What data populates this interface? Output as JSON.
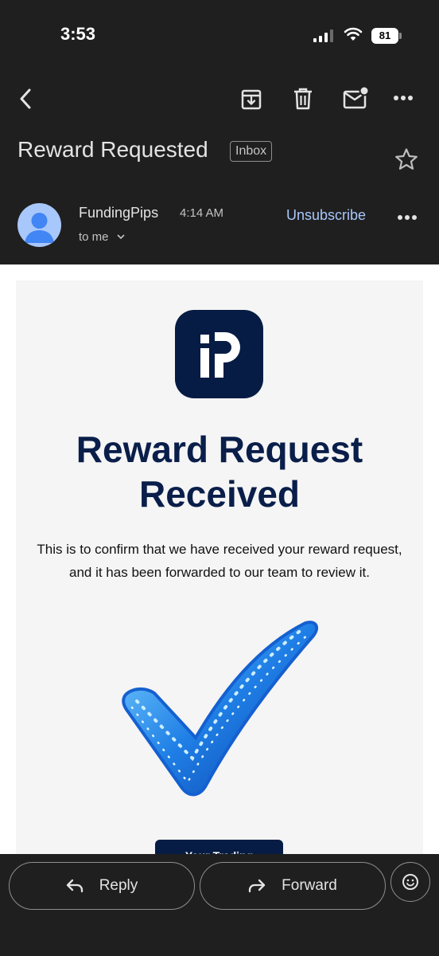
{
  "status_bar": {
    "time": "3:53",
    "battery": "81"
  },
  "header": {
    "icons": [
      "back-arrow-icon",
      "archive-icon",
      "trash-icon",
      "mark-unread-icon",
      "more-vert-icon"
    ],
    "subject": "Reward Requested",
    "label_chip": "Inbox"
  },
  "message": {
    "sender": "FundingPips",
    "time": "4:14 AM",
    "recipient": "to me",
    "unsubscribe": "Unsubscribe"
  },
  "email": {
    "headline_line1": "Reward Request",
    "headline_line2": "Received",
    "body_line1": "This is to confirm that we have received your reward request,",
    "body_line2": "and it has been forwarded to our team to review it.",
    "cta": "Your Trading"
  },
  "actions": {
    "reply": "Reply",
    "forward": "Forward"
  },
  "colors": {
    "header_bg": "#1f1f1f",
    "link_blue": "#a8c7fa",
    "brand_navy": "#061c44",
    "headline_navy": "#0a1e4a"
  }
}
